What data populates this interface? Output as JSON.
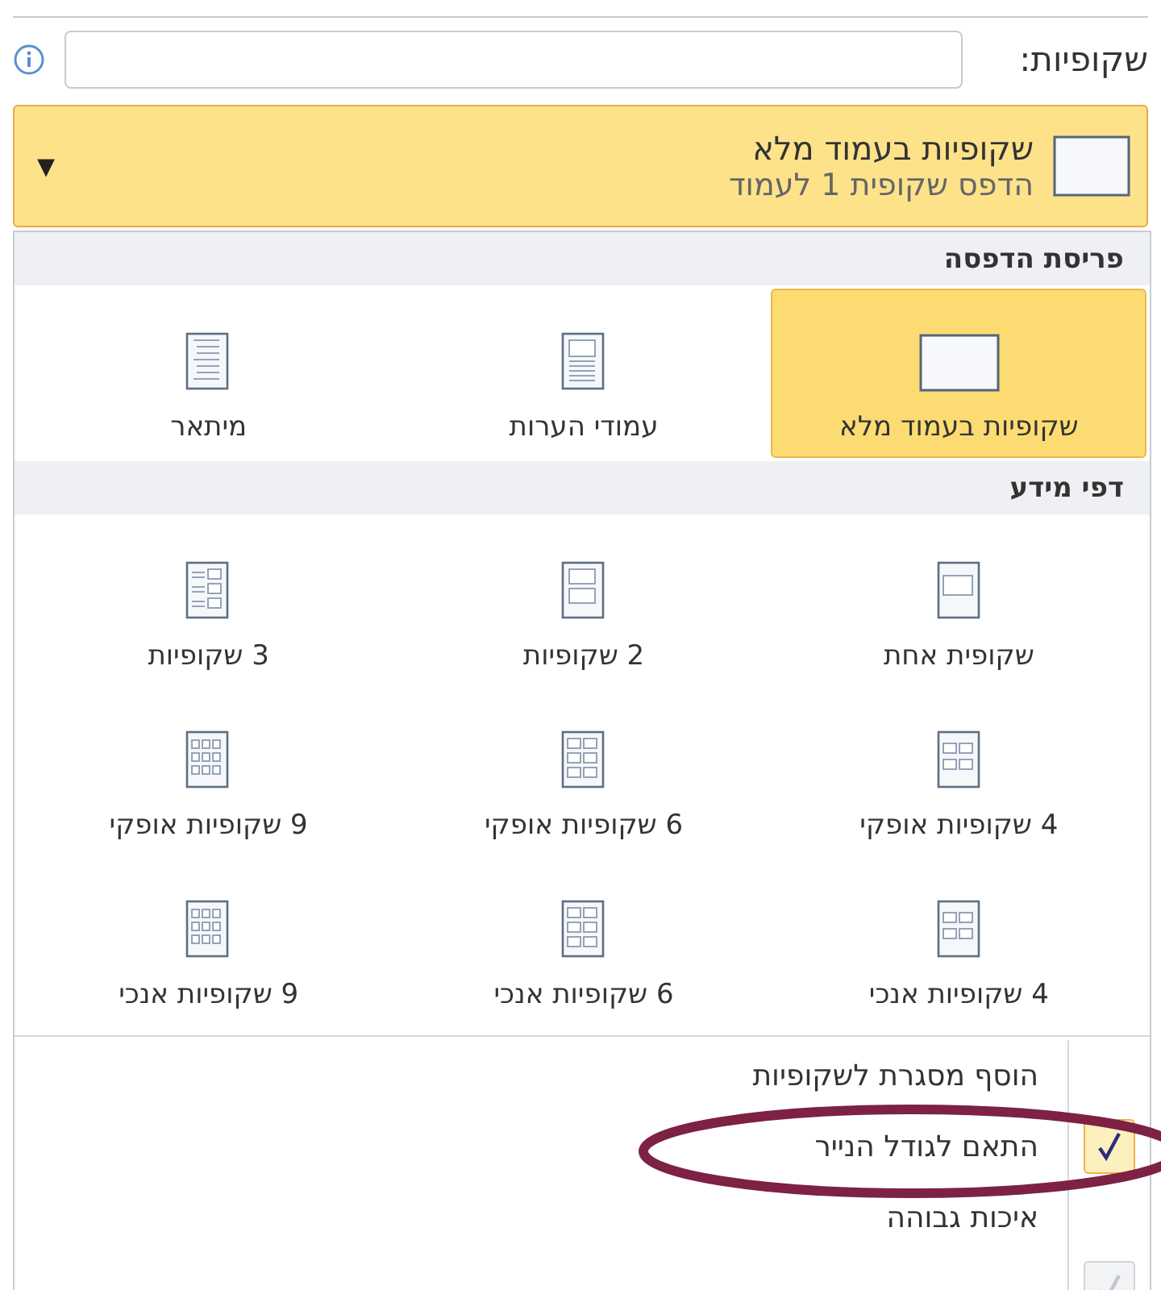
{
  "slides_label": "שקופיות:",
  "dropdown": {
    "title": "שקופיות בעמוד מלא",
    "subtitle": "הדפס שקופית 1 לעמוד",
    "arrow": "▾"
  },
  "sections": [
    {
      "title": "פריסת הדפסה",
      "items": [
        {
          "label": "שקופיות בעמוד מלא",
          "kind": "full",
          "selected": true
        },
        {
          "label": "עמודי הערות",
          "kind": "notes",
          "selected": false
        },
        {
          "label": "מיתאר",
          "kind": "outline",
          "selected": false
        }
      ]
    },
    {
      "title": "דפי מידע",
      "items": [
        {
          "label": "שקופית אחת",
          "kind": "h1",
          "selected": false
        },
        {
          "label": "2 שקופיות",
          "kind": "h2",
          "selected": false
        },
        {
          "label": "3 שקופיות",
          "kind": "h3",
          "selected": false
        },
        {
          "label": "4 שקופיות אופקי",
          "kind": "g4",
          "selected": false
        },
        {
          "label": "6 שקופיות אופקי",
          "kind": "g6",
          "selected": false
        },
        {
          "label": "9 שקופיות אופקי",
          "kind": "g9",
          "selected": false
        },
        {
          "label": "4 שקופיות אנכי",
          "kind": "g4",
          "selected": false
        },
        {
          "label": "6 שקופיות אנכי",
          "kind": "g6",
          "selected": false
        },
        {
          "label": "9 שקופיות אנכי",
          "kind": "g9",
          "selected": false
        }
      ]
    }
  ],
  "options": [
    {
      "label": "הוסף מסגרת לשקופיות",
      "checked": false,
      "disabled": false
    },
    {
      "label": "התאם לגודל הנייר",
      "checked": true,
      "disabled": false
    },
    {
      "label": "איכות גבוהה",
      "checked": false,
      "disabled": false
    },
    {
      "checked": true,
      "disabled": true
    }
  ]
}
